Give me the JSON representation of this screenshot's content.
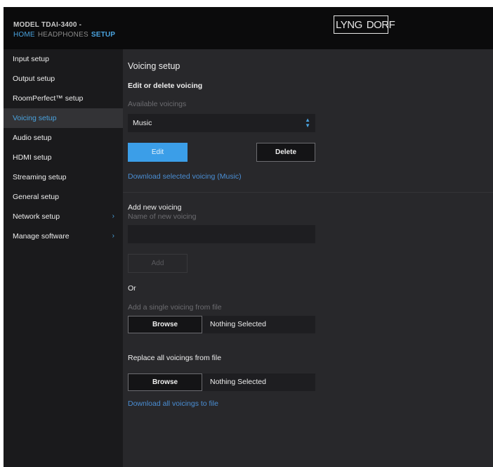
{
  "header": {
    "model": "MODEL TDAI-3400 -",
    "nav": {
      "home": "HOME",
      "headphones": "HEADPHONES",
      "setup": "SETUP"
    },
    "logo_left": "LYNG",
    "logo_right": "DORF"
  },
  "sidebar": {
    "items": [
      {
        "label": "Input setup"
      },
      {
        "label": "Output setup"
      },
      {
        "label": "RoomPerfect™ setup"
      },
      {
        "label": "Voicing setup",
        "active": true
      },
      {
        "label": "Audio setup"
      },
      {
        "label": "HDMI setup"
      },
      {
        "label": "Streaming setup"
      },
      {
        "label": "General setup"
      },
      {
        "label": "Network setup",
        "chevron": "›"
      },
      {
        "label": "Manage software",
        "chevron": "›"
      }
    ]
  },
  "main": {
    "title": "Voicing setup",
    "edit_section": {
      "heading": "Edit or delete voicing",
      "available_label": "Available voicings",
      "selected_voicing": "Music",
      "select_arrows": "▲▼",
      "edit_label": "Edit",
      "delete_label": "Delete",
      "download_link": "Download selected voicing (Music)"
    },
    "add_section": {
      "heading": "Add new voicing",
      "name_label": "Name of new voicing",
      "name_value": "",
      "add_label": "Add",
      "or_label": "Or",
      "single_file_label": "Add a single voicing from file",
      "browse_label": "Browse",
      "nothing_selected": "Nothing Selected",
      "replace_label": "Replace all voicings from file",
      "browse_label_2": "Browse",
      "nothing_selected_2": "Nothing Selected",
      "download_all_link": "Download all voicings to file"
    }
  },
  "colors": {
    "accent": "#4aa3df",
    "link": "#4a8ed4",
    "button_primary": "#3b9ee8",
    "sidebar_bg": "#1a1a1c",
    "main_bg": "#28282b",
    "header_bg": "#0b0b0c"
  }
}
